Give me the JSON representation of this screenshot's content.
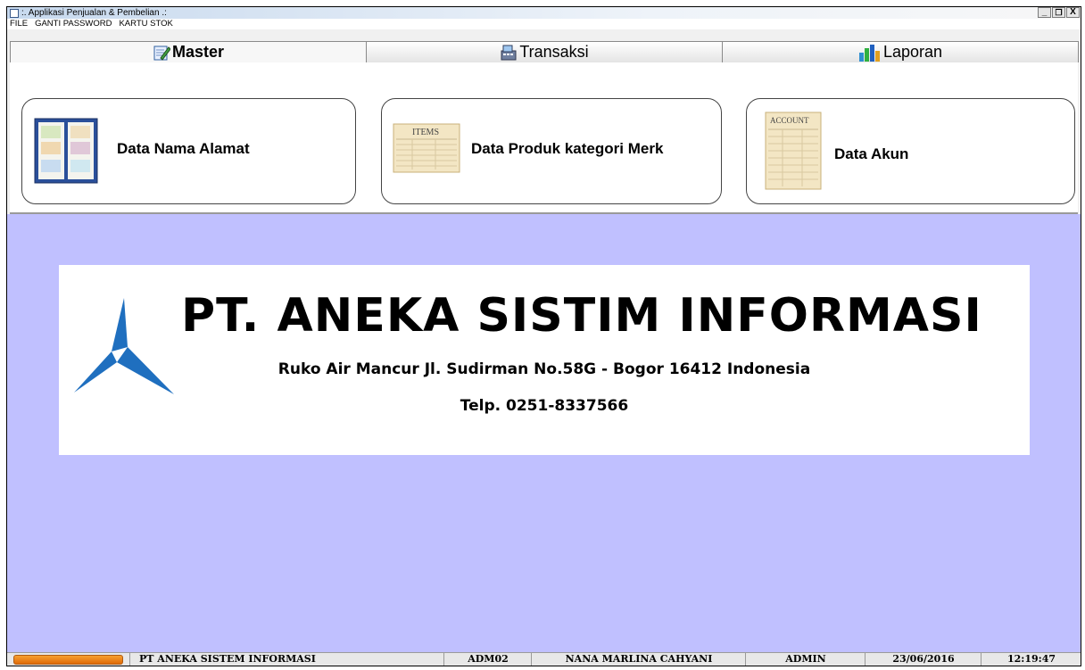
{
  "window": {
    "title": ":. Applikasi Penjualan & Pembelian .:",
    "controls": [
      "_",
      "Ɖ",
      "X"
    ]
  },
  "menu": [
    "FILE",
    "GANTI PASSWORD",
    "KARTU STOK"
  ],
  "tabs": [
    {
      "label": "Master",
      "icon": "edit-icon",
      "active": true
    },
    {
      "label": "Transaksi",
      "icon": "cash-register-icon",
      "active": false
    },
    {
      "label": "Laporan",
      "icon": "bar-chart-icon",
      "active": false
    }
  ],
  "cards": [
    {
      "label": "Data Nama Alamat",
      "icon": "address-book-icon"
    },
    {
      "label": "Data Produk kategori Merk",
      "icon": "items-ledger-icon",
      "icon_text": "ITEMS"
    },
    {
      "label": "Data Akun",
      "icon": "account-ledger-icon",
      "icon_text": "ACCOUNT"
    }
  ],
  "banner": {
    "company": "PT. ANEKA SISTIM INFORMASI",
    "address": "Ruko Air Mancur Jl. Sudirman No.58G - Bogor  16412 Indonesia",
    "phone": "Telp.  0251-8337566"
  },
  "status": {
    "company": "PT ANEKA SISTEM INFORMASI",
    "user_id": "ADM02",
    "user_name": "NANA MARLINA CAHYANI",
    "role": "ADMIN",
    "date": "23/06/2016",
    "time": "12:19:47"
  },
  "colors": {
    "content_bg": "#c0c0ff",
    "progress": "#f08020",
    "logo_blue": "#1f6fbf"
  }
}
